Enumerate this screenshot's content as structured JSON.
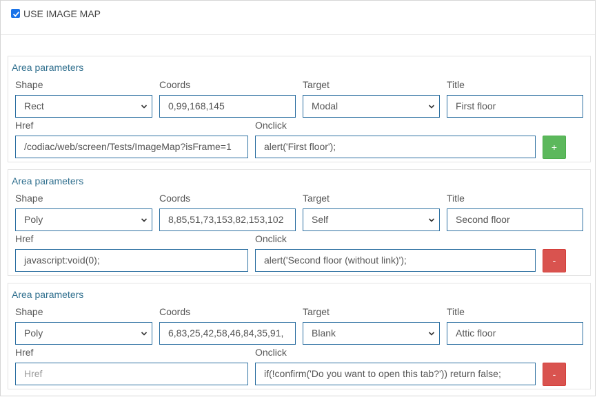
{
  "header": {
    "use_image_map_label": "USE IMAGE MAP",
    "use_image_map_checked": true
  },
  "labels": {
    "area_parameters": "Area parameters",
    "shape": "Shape",
    "coords": "Coords",
    "target": "Target",
    "title": "Title",
    "href": "Href",
    "onclick": "Onclick",
    "href_placeholder": "Href"
  },
  "areas": [
    {
      "shape": "Rect",
      "coords": "0,99,168,145",
      "target": "Modal",
      "title": "First floor",
      "href": "/codiac/web/screen/Tests/ImageMap?isFrame=1",
      "onclick": "alert('First floor');",
      "button": "+"
    },
    {
      "shape": "Poly",
      "coords": "8,85,51,73,153,82,153,102",
      "target": "Self",
      "title": "Second floor",
      "href": "javascript:void(0);",
      "onclick": "alert('Second floor (without link)');",
      "button": "-"
    },
    {
      "shape": "Poly",
      "coords": "6,83,25,42,58,46,84,35,91,",
      "target": "Blank",
      "title": "Attic floor",
      "href": "",
      "onclick": "if(!confirm('Do you want to open this tab?')) return false;",
      "button": "-"
    }
  ]
}
